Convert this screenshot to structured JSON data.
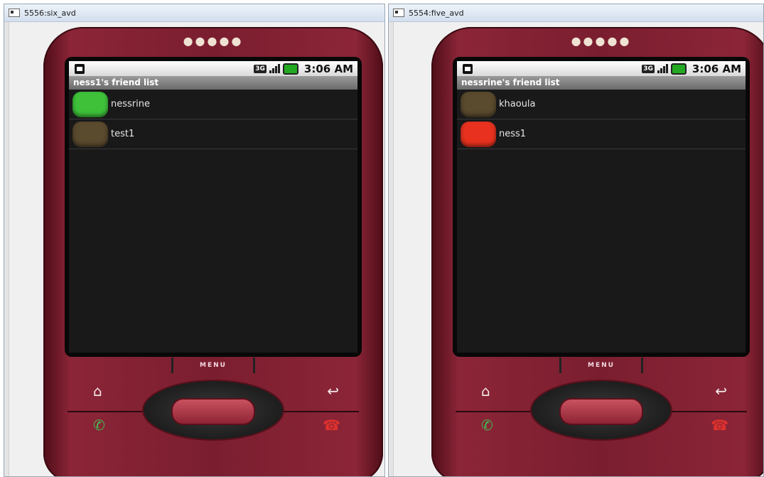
{
  "windows": [
    {
      "title": "5556:six_avd",
      "clock": "3:06 AM",
      "network": "3G",
      "list_title": "ness1's friend list",
      "friends": [
        {
          "name": "nessrine",
          "status_color": "#3fc23a"
        },
        {
          "name": "test1",
          "status_color": "#5a4a2e"
        }
      ],
      "menu_label": "MENU"
    },
    {
      "title": "5554:five_avd",
      "clock": "3:06 AM",
      "network": "3G",
      "list_title": "nessrine's friend list",
      "friends": [
        {
          "name": "khaoula",
          "status_color": "#5a4a2e"
        },
        {
          "name": "ness1",
          "status_color": "#e8321f"
        }
      ],
      "menu_label": "MENU"
    }
  ],
  "icons": {
    "home": "home-icon",
    "back": "back-icon",
    "call": "call-icon",
    "end_call": "end-call-icon",
    "signal": "signal-icon",
    "battery": "battery-icon",
    "sim": "sim-icon"
  }
}
